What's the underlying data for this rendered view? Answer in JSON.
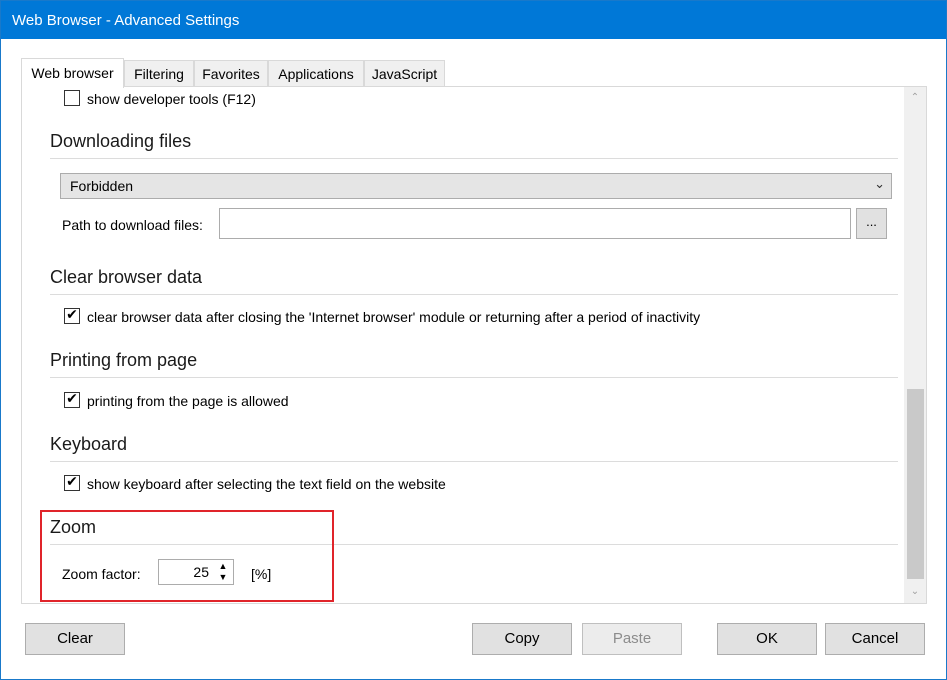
{
  "window": {
    "title": "Web Browser - Advanced Settings"
  },
  "tabs": [
    {
      "label": "Web browser",
      "active": true
    },
    {
      "label": "Filtering",
      "active": false
    },
    {
      "label": "Favorites",
      "active": false
    },
    {
      "label": "Applications",
      "active": false
    },
    {
      "label": "JavaScript",
      "active": false
    }
  ],
  "settings": {
    "dev_tools": {
      "label": "show developer tools (F12)",
      "checked": false
    },
    "downloading": {
      "title": "Downloading files",
      "mode_selected": "Forbidden",
      "path_label": "Path to download files:",
      "path_value": "",
      "browse_label": "..."
    },
    "clear_data": {
      "title": "Clear browser data",
      "checkbox_label": "clear browser data after closing the 'Internet browser' module or returning after a period of inactivity",
      "checked": true
    },
    "printing": {
      "title": "Printing from page",
      "checkbox_label": "printing from the page is allowed",
      "checked": true
    },
    "keyboard": {
      "title": "Keyboard",
      "checkbox_label": "show keyboard after selecting the text field on the website",
      "checked": true
    },
    "zoom": {
      "title": "Zoom",
      "factor_label": "Zoom factor:",
      "factor_value": "25",
      "unit": "[%]"
    }
  },
  "buttons": {
    "clear": "Clear",
    "copy": "Copy",
    "paste": "Paste",
    "ok": "OK",
    "cancel": "Cancel"
  },
  "checkmark_glyph": "✔",
  "colors": {
    "titlebar": "#0078d7",
    "highlight": "#e0242a"
  }
}
